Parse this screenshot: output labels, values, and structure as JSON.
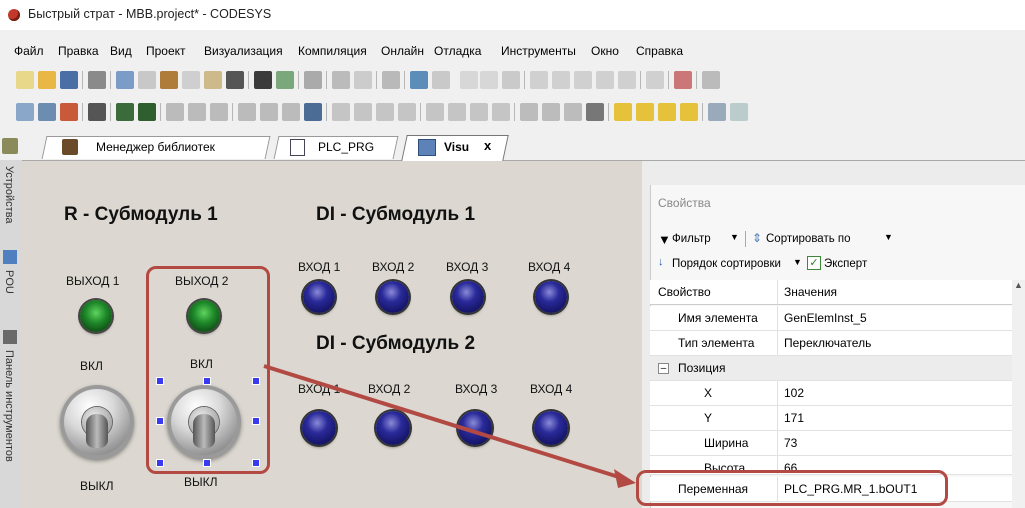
{
  "window": {
    "title": "Быстрый страт - MBB.project* - CODESYS"
  },
  "menu": [
    "Файл",
    "Правка",
    "Вид",
    "Проект",
    "Визуализация",
    "Компиляция",
    "Онлайн",
    "Отладка",
    "Инструменты",
    "Окно",
    "Справка"
  ],
  "tabs": [
    {
      "label": "Менеджер библиотек"
    },
    {
      "label": "PLC_PRG"
    },
    {
      "label": "Visu",
      "close": "x"
    }
  ],
  "side_panels": [
    "Устройства",
    "POU",
    "Панель инструментов"
  ],
  "visu": {
    "r_title": "R - Субмодуль 1",
    "di1_title": "DI - Субмодуль 1",
    "di2_title": "DI - Субмодуль 2",
    "out1": "ВЫХОД 1",
    "out2": "ВЫХОД 2",
    "on": "ВКЛ",
    "off": "ВЫКЛ",
    "in1": "ВХОД 1",
    "in2": "ВХОД 2",
    "in3": "ВХОД 3",
    "in4": "ВХОД 4"
  },
  "properties": {
    "title": "Свойства",
    "filter": "Фильтр",
    "sort_by": "Сортировать по",
    "sort_order": "Порядок сортировки",
    "expert": "Эксперт",
    "expert_checked": true,
    "col_property": "Свойство",
    "col_values": "Значения",
    "rows": [
      {
        "key": "Имя элемента",
        "value": "GenElemInst_5"
      },
      {
        "key": "Тип элемента",
        "value": "Переключатель"
      },
      {
        "key": "Позиция",
        "value": ""
      },
      {
        "key": "X",
        "value": "102"
      },
      {
        "key": "Y",
        "value": "171"
      },
      {
        "key": "Ширина",
        "value": "73"
      },
      {
        "key": "Высота",
        "value": "66"
      },
      {
        "key": "Переменная",
        "value": "PLC_PRG.MR_1.bOUT1"
      }
    ]
  },
  "colors": {
    "highlight": "#b24a43",
    "led_blue": "#1e1e88",
    "led_green": "#1f8a2a"
  }
}
